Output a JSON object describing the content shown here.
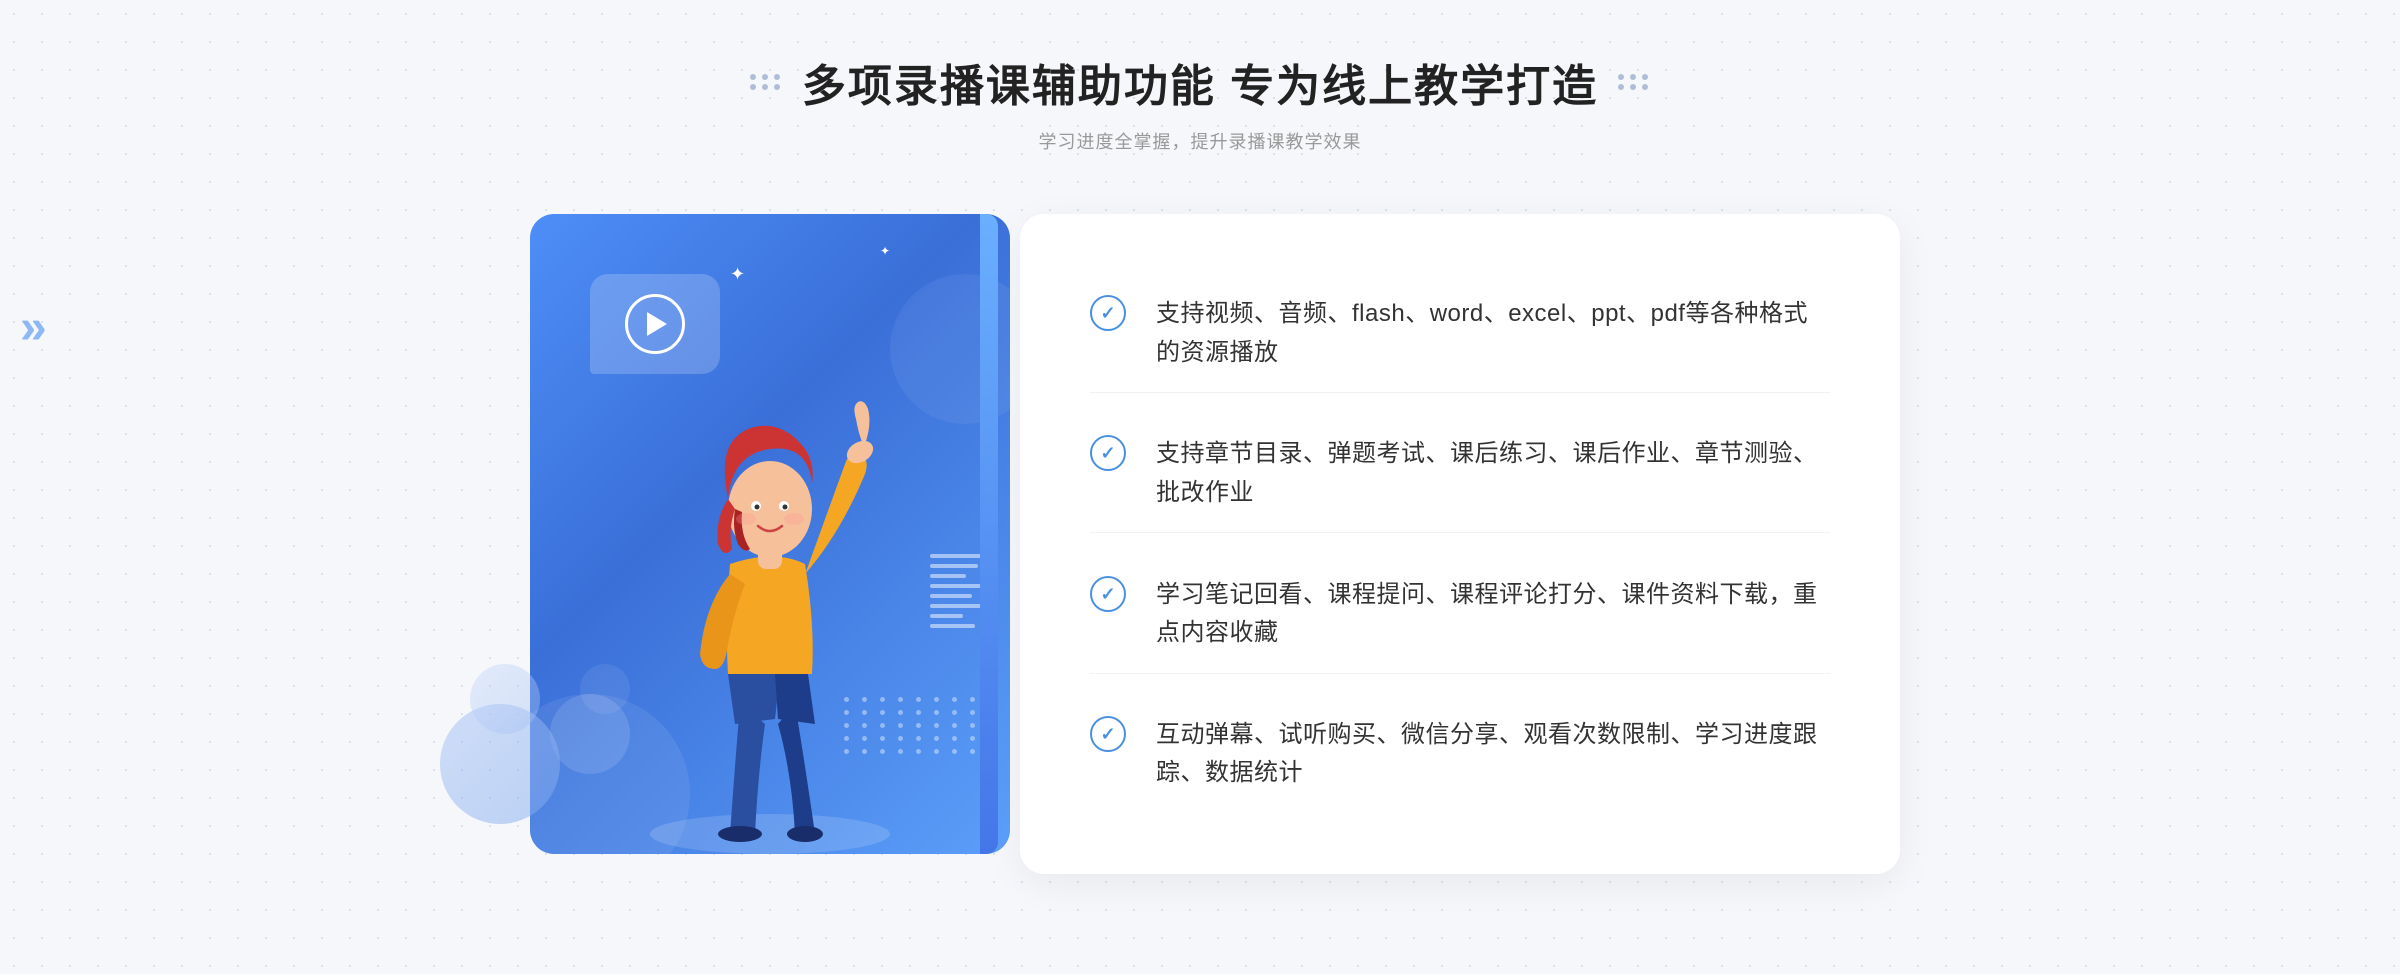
{
  "header": {
    "title": "多项录播课辅助功能 专为线上教学打造",
    "subtitle": "学习进度全掌握，提升录播课教学效果"
  },
  "features": [
    {
      "id": "feature-1",
      "text": "支持视频、音频、flash、word、excel、ppt、pdf等各种格式的资源播放"
    },
    {
      "id": "feature-2",
      "text": "支持章节目录、弹题考试、课后练习、课后作业、章节测验、批改作业"
    },
    {
      "id": "feature-3",
      "text": "学习笔记回看、课程提问、课程评论打分、课件资料下载，重点内容收藏"
    },
    {
      "id": "feature-4",
      "text": "互动弹幕、试听购买、微信分享、观看次数限制、学习进度跟踪、数据统计"
    }
  ],
  "decorations": {
    "left_chevron": "»",
    "dot_color": "#b0bdd8",
    "accent_color": "#4a8ef5"
  }
}
